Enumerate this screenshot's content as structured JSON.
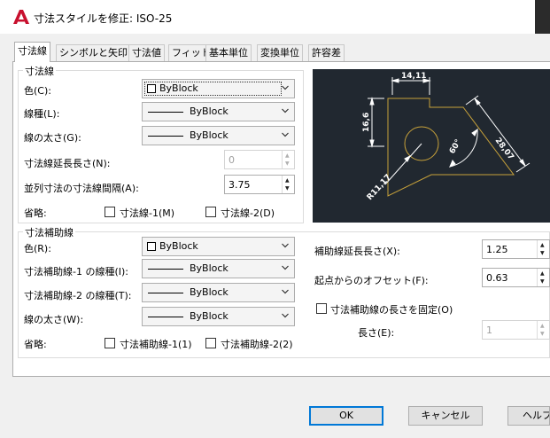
{
  "window": {
    "title": "寸法スタイルを修正: ISO-25",
    "app_icon": "autocad-logo",
    "accent_color": "#c8102e"
  },
  "tabs": [
    {
      "label": "寸法線",
      "active": true
    },
    {
      "label": "シンボルと矢印",
      "active": false
    },
    {
      "label": "寸法値",
      "active": false
    },
    {
      "label": "フィット",
      "active": false
    },
    {
      "label": "基本単位",
      "active": false
    },
    {
      "label": "変換単位",
      "active": false
    },
    {
      "label": "許容差",
      "active": false
    }
  ],
  "dim_lines": {
    "group_title": "寸法線",
    "color_label": "色(C):",
    "color_value": "ByBlock",
    "linetype_label": "線種(L):",
    "linetype_value": "ByBlock",
    "lineweight_label": "線の太さ(G):",
    "lineweight_value": "ByBlock",
    "extend_label": "寸法線延長長さ(N):",
    "extend_value": "0",
    "baseline_label": "並列寸法の寸法線間隔(A):",
    "baseline_value": "3.75",
    "suppress_label": "省略:",
    "suppress1_label": "寸法線-1(M)",
    "suppress2_label": "寸法線-2(D)"
  },
  "ext_lines": {
    "group_title": "寸法補助線",
    "color_label": "色(R):",
    "color_value": "ByBlock",
    "linetype1_label": "寸法補助線-1 の線種(I):",
    "linetype1_value": "ByBlock",
    "linetype2_label": "寸法補助線-2 の線種(T):",
    "linetype2_value": "ByBlock",
    "lineweight_label": "線の太さ(W):",
    "lineweight_value": "ByBlock",
    "suppress_label": "省略:",
    "suppress1_label": "寸法補助線-1(1)",
    "suppress2_label": "寸法補助線-2(2)",
    "extend_beyond_label": "補助線延長長さ(X):",
    "extend_beyond_value": "1.25",
    "offset_label": "起点からのオフセット(F):",
    "offset_value": "0.63",
    "fixed_length_label": "寸法補助線の長さを固定(O)",
    "length_label": "長さ(E):",
    "length_value": "1"
  },
  "preview": {
    "dim_top": "14,11",
    "dim_left": "16,6",
    "dim_aligned": "28,07",
    "dim_angle": "60°",
    "dim_radius": "R11,17",
    "background": "#212830",
    "geometry_color": "#c8a23a",
    "dim_color": "#ffffff"
  },
  "buttons": {
    "ok": "OK",
    "cancel": "キャンセル",
    "help": "ヘルプ"
  }
}
